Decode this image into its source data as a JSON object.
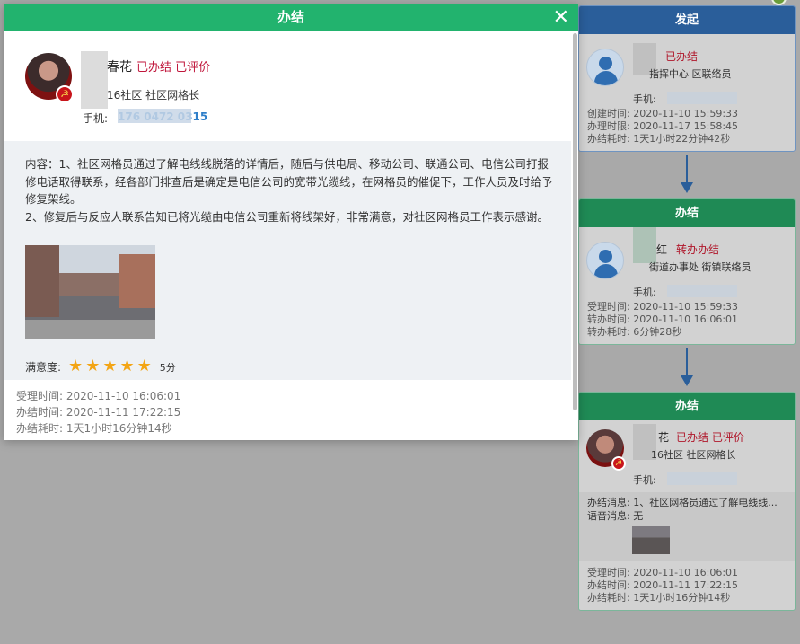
{
  "modal": {
    "title": "办结",
    "close_glyph": "✕",
    "person": {
      "name": "春花",
      "status": "已办结 已评价",
      "org": "16社区  社区网格长",
      "phone_label": "手机:",
      "phone": "176 0472 0315"
    },
    "content_text": "内容：1、社区网格员通过了解电线线脱落的详情后，随后与供电局、移动公司、联通公司、电信公司打报修电话取得联系，经各部门排查后是确定是电信公司的宽带光缆线，在网格员的催促下，工作人员及时给予修复架线。\n2、修复后与反应人联系告知已将光缆由电信公司重新将线架好，非常满意，对社区网格员工作表示感谢。",
    "rating_label": "满意度:",
    "rating_stars": 5,
    "rating_score": "5分",
    "times": {
      "accept": "受理时间: 2020-11-10 16:06:01",
      "finish": "办结时间: 2020-11-11 17:22:15",
      "duration": "办结耗时: 1天1小时16分钟14秒"
    }
  },
  "timeline": [
    {
      "title": "发起",
      "color": "#2a5e9a",
      "name": "",
      "status": "已办结",
      "org": "指挥中心  区联络员",
      "phone_label": "手机:",
      "lines": [
        "创建时间: 2020-11-10 15:59:33",
        "办理时限: 2020-11-17 15:58:45",
        "办结耗时: 1天1小时22分钟42秒"
      ]
    },
    {
      "title": "办结",
      "color": "#1f8a55",
      "name": "红",
      "status": "转办办结",
      "org": "街道办事处  街镇联络员",
      "phone_label": "手机:",
      "lines": [
        "受理时间: 2020-11-10 15:59:33",
        "转办时间: 2020-11-10 16:06:01",
        "转办耗时: 6分钟28秒"
      ]
    },
    {
      "title": "办结",
      "color": "#1f8a55",
      "name": "花",
      "status": "已办结 已评价",
      "org": "16社区  社区网格长",
      "phone_label": "手机:",
      "msg": "办结消息: 1、社区网格员通过了解电线线...",
      "voice": "语音消息: 无",
      "lines": [
        "受理时间: 2020-11-10 16:06:01",
        "办结时间: 2020-11-11 17:22:15",
        "办结耗时: 1天1小时16分钟14秒"
      ]
    }
  ]
}
